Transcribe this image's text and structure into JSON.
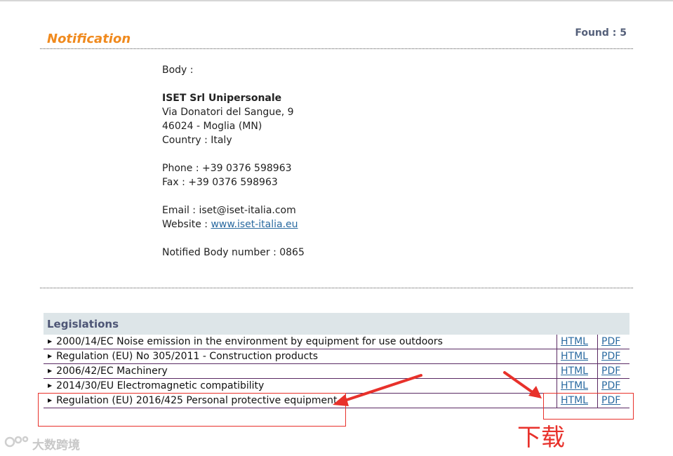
{
  "header": {
    "title": "Notification",
    "found": "Found : 5"
  },
  "body": {
    "label": "Body :",
    "name": "ISET Srl Unipersonale",
    "address1": "Via Donatori del Sangue, 9",
    "address2": "46024 - Moglia (MN)",
    "country": "Country : Italy",
    "phone": "Phone : +39 0376 598963",
    "fax": "Fax : +39 0376 598963",
    "email": "Email : iset@iset-italia.com",
    "website_label": "Website : ",
    "website_url": "www.iset-italia.eu",
    "notified": "Notified Body number : 0865"
  },
  "legislations": {
    "title": "Legislations",
    "html_label": "HTML",
    "pdf_label": "PDF",
    "items": [
      "2000/14/EC Noise emission in the environment by equipment for use outdoors",
      "Regulation (EU) No 305/2011 - Construction products",
      "2006/42/EC Machinery",
      "2014/30/EU Electromagnetic compatibility",
      "Regulation (EU) 2016/425 Personal protective equipment"
    ]
  },
  "annotation": {
    "label": "下载",
    "color": "#e8312b"
  },
  "watermark": "大数跨境"
}
